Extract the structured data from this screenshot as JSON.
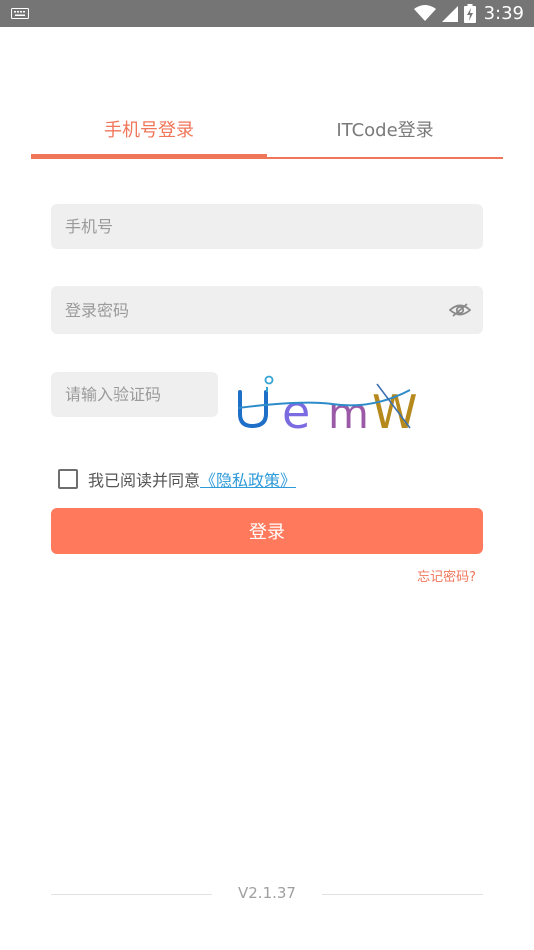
{
  "status_bar": {
    "time": "3:39",
    "icons": [
      "keyboard-icon",
      "wifi-icon",
      "signal-icon",
      "battery-icon"
    ]
  },
  "tabs": [
    {
      "label": "手机号登录",
      "active": true
    },
    {
      "label": "ITCode登录",
      "active": false
    }
  ],
  "form": {
    "phone_placeholder": "手机号",
    "password_placeholder": "登录密码",
    "code_placeholder": "请输入验证码",
    "captcha_text": "UemW"
  },
  "agreement": {
    "text": "我已阅读并同意",
    "link": "《隐私政策》",
    "checked": false
  },
  "login_button": "登录",
  "forgot_password": "忘记密码?",
  "version": "V2.1.37",
  "colors": {
    "accent": "#F0765A",
    "button": "#FF7A5C",
    "link": "#2F9BD8"
  }
}
